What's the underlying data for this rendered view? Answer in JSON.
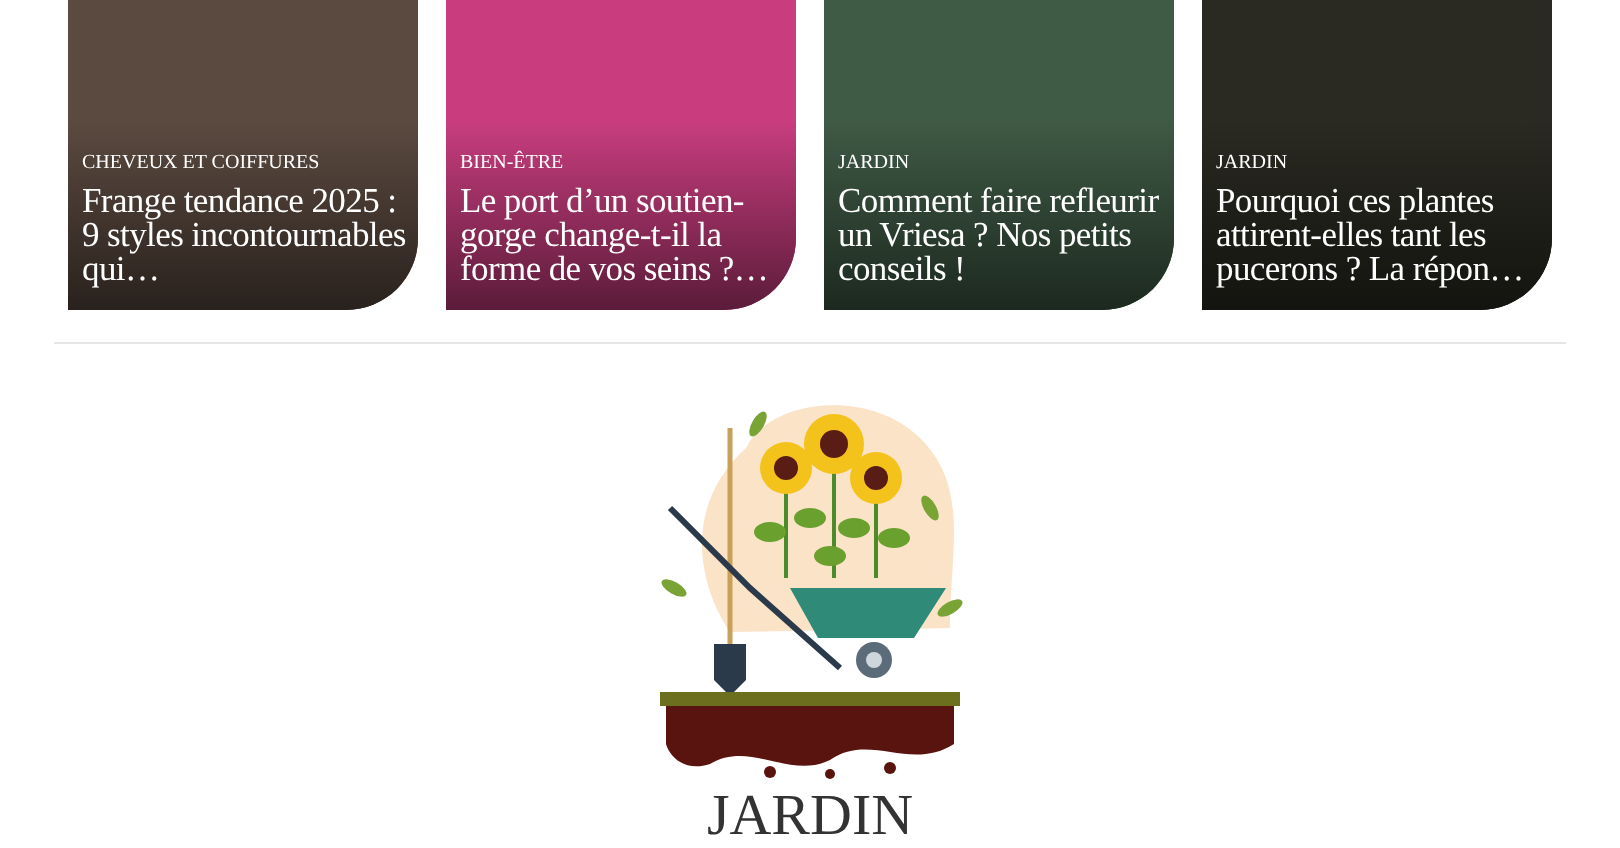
{
  "articles": [
    {
      "category": "CHEVEUX ET COIFFURES",
      "title": "Frange tendance 2025 : 9 styles incontournables qui…"
    },
    {
      "category": "BIEN-ÊTRE",
      "title": "Le port d’un soutien-gorge change-t-il la forme de vos seins ?…"
    },
    {
      "category": "JARDIN",
      "title": "Comment faire refleurir un Vriesa ? Nos petits conseils !"
    },
    {
      "category": "JARDIN",
      "title": "Pourquoi ces plantes attirent-elles tant les pucerons ? La répon…"
    }
  ],
  "section": {
    "title": "JARDIN"
  }
}
